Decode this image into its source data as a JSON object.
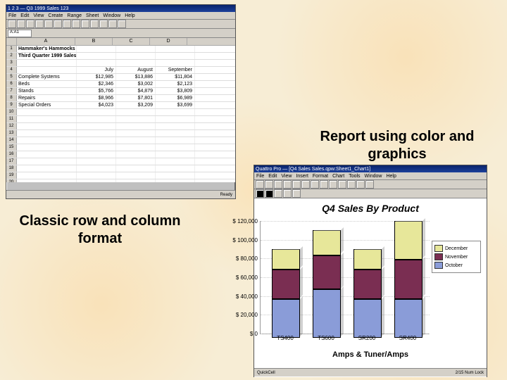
{
  "captions": {
    "classic": "Classic row and column format",
    "color": "Report using color and graphics"
  },
  "spreadsheet": {
    "title_bar": "1 2 3 — Q3 1999 Sales 123",
    "menu": [
      "File",
      "Edit",
      "View",
      "Create",
      "Range",
      "Sheet",
      "Window",
      "Help"
    ],
    "cell_ref": "A:A1",
    "col_letters": [
      "A",
      "B",
      "C",
      "D"
    ],
    "title1": "Hammaker's Hammocks",
    "title2": "Third Quarter 1999 Sales",
    "headers": [
      "July",
      "August",
      "September"
    ],
    "rows": [
      {
        "label": "Complete Systems",
        "vals": [
          "$12,985",
          "$13,886",
          "$11,804"
        ]
      },
      {
        "label": "Beds",
        "vals": [
          "$2,346",
          "$3,002",
          "$2,123"
        ]
      },
      {
        "label": "Stands",
        "vals": [
          "$5,766",
          "$4,879",
          "$3,809"
        ]
      },
      {
        "label": "Repairs",
        "vals": [
          "$8,966",
          "$7,801",
          "$6,989"
        ]
      },
      {
        "label": "Special Orders",
        "vals": [
          "$4,023",
          "$3,209",
          "$3,699"
        ]
      }
    ],
    "status": "Ready"
  },
  "chart_window": {
    "title_bar": "Quattro Pro — [Q4 Sales Sales.qpw:Sheet1_Chart1]",
    "menu": [
      "File",
      "Edit",
      "View",
      "Insert",
      "Format",
      "Chart",
      "Tools",
      "Window",
      "Help"
    ],
    "status_left": "QuickCell",
    "status_right": "2/15 Num Lock"
  },
  "chart_data": {
    "type": "bar",
    "title": "Q4 Sales By Product",
    "subtitle": "Amps & Tuner/Amps",
    "xlabel": "",
    "ylabel": "$",
    "categories": [
      "TS400",
      "TS600",
      "SR200",
      "SR400"
    ],
    "series": [
      {
        "name": "October",
        "values": [
          40000,
          50000,
          40000,
          40000
        ]
      },
      {
        "name": "November",
        "values": [
          30000,
          35000,
          30000,
          40000
        ]
      },
      {
        "name": "December",
        "values": [
          20000,
          25000,
          20000,
          40000
        ]
      }
    ],
    "y_ticks": [
      0,
      20000,
      40000,
      60000,
      80000,
      100000,
      120000
    ],
    "y_tick_labels": [
      "$       0",
      "$  20,000",
      "$  40,000",
      "$  60,000",
      "$  80,000",
      "$ 100,000",
      "$ 120,000"
    ],
    "ylim": [
      0,
      120000
    ],
    "legend": [
      "December",
      "November",
      "October"
    ]
  }
}
